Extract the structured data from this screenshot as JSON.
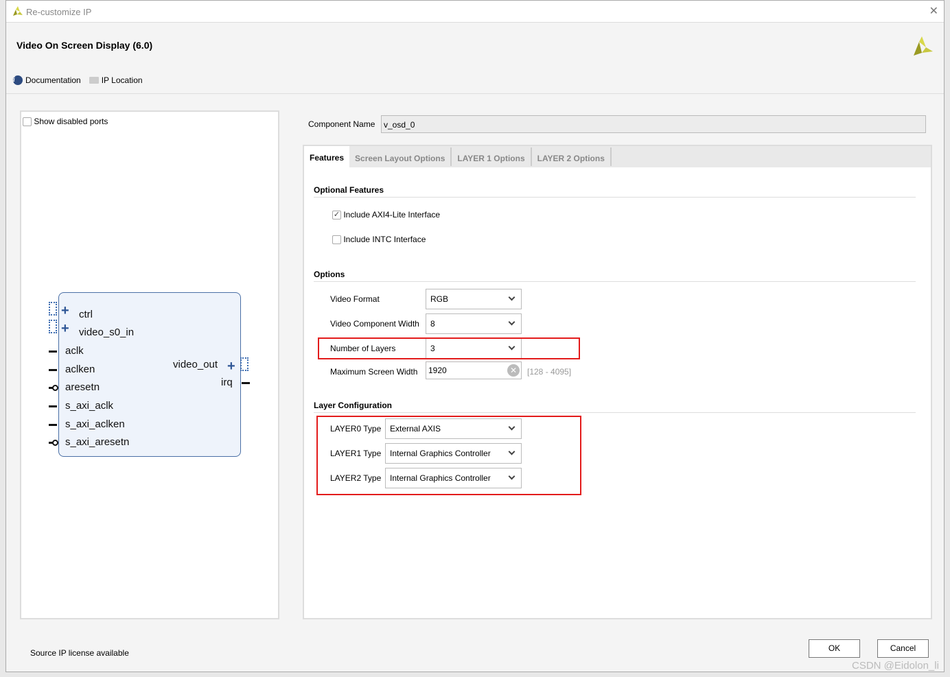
{
  "window": {
    "title": "Re-customize IP",
    "close_icon": "close-icon"
  },
  "header": {
    "title": "Video On Screen Display (6.0)",
    "documentation": "Documentation",
    "ip_location": "IP Location"
  },
  "left": {
    "show_disabled_ports": "Show disabled ports",
    "show_disabled_checked": false,
    "left_ports": [
      "ctrl",
      "video_s0_in",
      "aclk",
      "aclken",
      "aresetn",
      "s_axi_aclk",
      "s_axi_aclken",
      "s_axi_aresetn"
    ],
    "right_ports": [
      "video_out",
      "irq"
    ]
  },
  "component": {
    "label": "Component Name",
    "value": "v_osd_0"
  },
  "tabs": [
    "Features",
    "Screen Layout Options",
    "LAYER 1 Options",
    "LAYER 2 Options"
  ],
  "features": {
    "optional_title": "Optional Features",
    "axi_lite": {
      "label": "Include AXI4-Lite Interface",
      "checked": true
    },
    "intc": {
      "label": "Include INTC Interface",
      "checked": false
    },
    "options_title": "Options",
    "video_format": {
      "label": "Video Format",
      "value": "RGB"
    },
    "component_width": {
      "label": "Video Component Width",
      "value": "8"
    },
    "num_layers": {
      "label": "Number of Layers",
      "value": "3"
    },
    "max_width": {
      "label": "Maximum Screen Width",
      "value": "1920",
      "range": "[128 - 4095]"
    },
    "layer_title": "Layer Configuration",
    "layers": [
      {
        "label": "LAYER0 Type",
        "value": "External AXIS"
      },
      {
        "label": "LAYER1 Type",
        "value": "Internal Graphics Controller"
      },
      {
        "label": "LAYER2 Type",
        "value": "Internal Graphics Controller"
      }
    ]
  },
  "footer": {
    "license": "Source IP license available",
    "ok": "OK",
    "cancel": "Cancel",
    "watermark": "CSDN @Eidolon_li"
  },
  "colors": {
    "highlight": "#e31b1b",
    "accent": "#2d5595"
  }
}
